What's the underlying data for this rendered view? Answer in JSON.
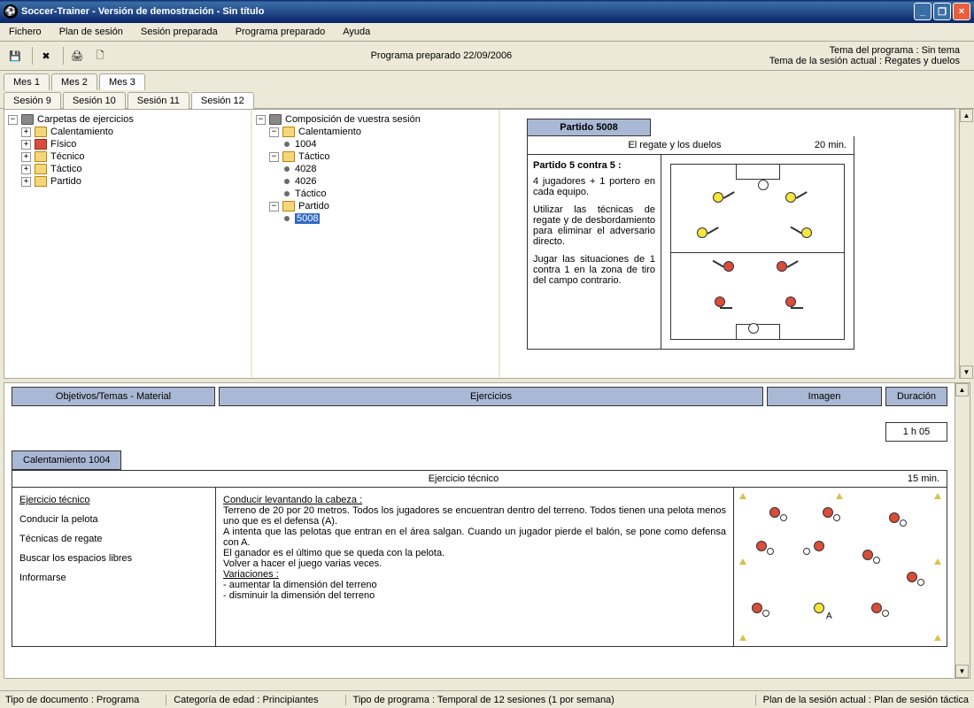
{
  "title": "Soccer-Trainer - Versión de demostración - Sin título",
  "menu": {
    "file": "Fichero",
    "plan": "Plan de sesión",
    "prep": "Sesión preparada",
    "prog": "Programa preparado",
    "help": "Ayuda"
  },
  "info": {
    "date": "Programa preparado 22/09/2006",
    "theme": "Tema del programa : Sin tema",
    "session_theme": "Tema de la sesión actual : Regates y duelos"
  },
  "months": [
    "Mes 1",
    "Mes 2",
    "Mes 3"
  ],
  "active_month": 2,
  "sessions": [
    "Sesión 9",
    "Sesión 10",
    "Sesión 11",
    "Sesión 12"
  ],
  "active_session": 3,
  "tree_left": {
    "root": "Carpetas de ejercicios",
    "items": [
      "Calentamiento",
      "Físico",
      "Técnico",
      "Táctico",
      "Partido"
    ]
  },
  "tree_right": {
    "root": "Composición de vuestra sesión",
    "groups": [
      {
        "name": "Calentamiento",
        "items": [
          "1004"
        ]
      },
      {
        "name": "Táctico",
        "items": [
          "4028",
          "4026",
          "Táctico"
        ]
      },
      {
        "name": "Partido",
        "items": [
          "5008"
        ]
      }
    ],
    "selected": "5008"
  },
  "card": {
    "header": "Partido 5008",
    "title": "El regate y los duelos",
    "duration": "20 min.",
    "subtitle": "Partido 5 contra 5 :",
    "p1": "4 jugadores + 1 portero en cada equipo.",
    "p2": "Utilizar las técnicas de regate y de desbordamiento para eliminar el adversario directo.",
    "p3": "Jugar las situaciones de 1 contra 1 en la zona de tiro del campo contrario."
  },
  "headers": {
    "obj": "Objetivos/Temas - Material",
    "ej": "Ejercicios",
    "img": "Imagen",
    "dur": "Duración"
  },
  "total": "1 h 05",
  "exercise": {
    "tab": "Calentamiento 1004",
    "title": "Ejercicio técnico",
    "duration": "15 min.",
    "obj_title": "Ejercicio técnico",
    "objs": [
      "Conducir la pelota",
      "Técnicas de regate",
      "Buscar los espacios libres",
      "Informarse"
    ],
    "desc_title": "Conducir levantando la cabeza :",
    "desc1": "Terreno de 20 por 20 metros. Todos los jugadores se encuentran dentro del terreno. Todos tienen una pelota menos uno que es el defensa (A).",
    "desc2": "A intenta que las pelotas que entran en el área salgan. Cuando un jugador pierde el balón, se pone como defensa con A.",
    "desc3": "El ganador es el último que se queda con la pelota.",
    "desc4": "Volver a hacer el juego varias veces.",
    "var_title": "Variaciones :",
    "var1": "- aumentar la dimensión del terreno",
    "var2": "- disminuir la dimensión del terreno"
  },
  "status": {
    "doc": "Tipo de documento : Programa",
    "age": "Categoría de edad : Principiantes",
    "tipo": "Tipo de programa : Temporal de 12 sesiones (1 por semana)",
    "plan": "Plan de la sesión actual : Plan de sesión táctica"
  }
}
